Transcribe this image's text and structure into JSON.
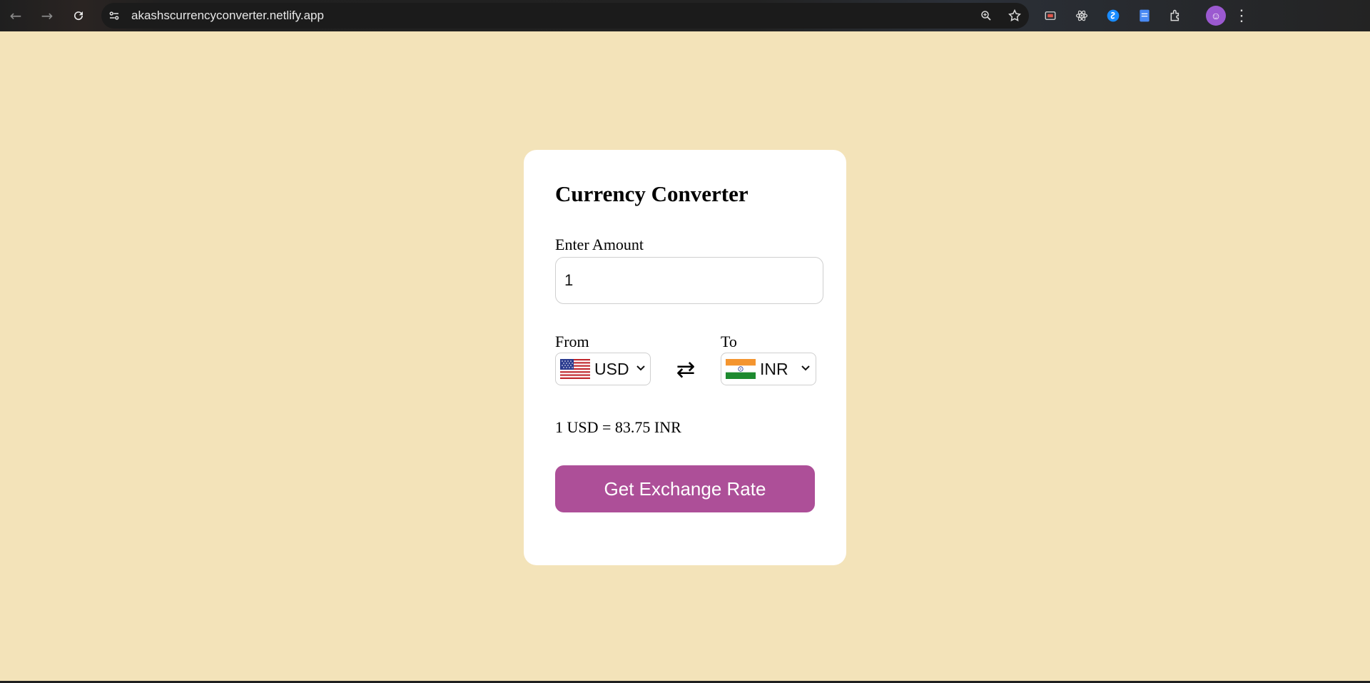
{
  "browser": {
    "url": "akashscurrencyconverter.netlify.app",
    "icons": [
      "back-icon",
      "forward-icon",
      "reload-icon",
      "site-info-icon",
      "zoom-icon",
      "star-icon",
      "cast-icon",
      "react-devtools-icon",
      "shazam-icon",
      "docs-icon",
      "extensions-icon",
      "profile-icon",
      "menu-icon"
    ]
  },
  "card": {
    "title": "Currency Converter",
    "amount_label": "Enter Amount",
    "amount_value": "1",
    "from_label": "From",
    "from_currency": "USD",
    "to_label": "To",
    "to_currency": "INR",
    "swap_icon": "⇄",
    "rate_message": "1 USD = 83.75 INR",
    "button_label": "Get Exchange Rate"
  },
  "colors": {
    "background": "#f3e3b9",
    "card": "#ffffff",
    "button": "#ad4f98"
  }
}
